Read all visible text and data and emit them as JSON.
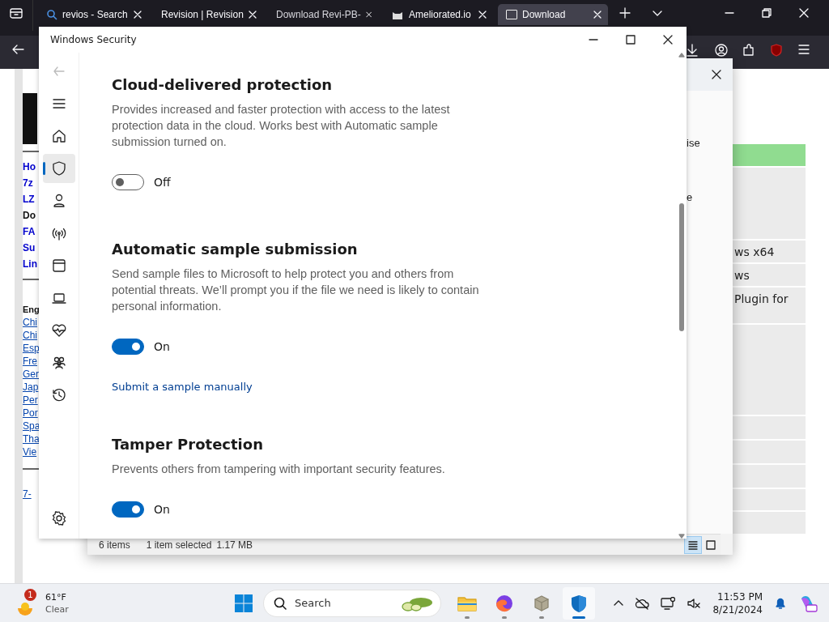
{
  "browser": {
    "tabs": [
      {
        "label": "revios - Search",
        "selected": false
      },
      {
        "label": "Revision | Revision",
        "selected": false
      },
      {
        "label": "Download Revi-PB-",
        "selected": false
      },
      {
        "label": "Ameliorated.io",
        "selected": false
      },
      {
        "label": "Download",
        "selected": true
      }
    ]
  },
  "web_page": {
    "nav_links": [
      {
        "text": "Ho",
        "kind": "link"
      },
      {
        "text": "7z",
        "kind": "link"
      },
      {
        "text": "LZ",
        "kind": "link"
      },
      {
        "text": "Do",
        "kind": "current"
      },
      {
        "text": "FA",
        "kind": "link"
      },
      {
        "text": "Su",
        "kind": "link"
      },
      {
        "text": "Lin",
        "kind": "link"
      }
    ],
    "languages_heading": "Eng",
    "languages": [
      "Chi",
      "Chi",
      "Esp",
      "Fre",
      "Ger",
      "Jap",
      "Per",
      "Por",
      "Spa",
      "Tha",
      "Vie"
    ],
    "footer_link": "7-",
    "table_rows": [
      {
        "text": "ws x64"
      },
      {
        "text": "ws"
      },
      {
        "text": "Plugin for"
      }
    ]
  },
  "file_explorer": {
    "pane_texts": [
      "ise",
      "e"
    ],
    "status_bar": {
      "item_count": "6 items",
      "selection": "1 item selected",
      "size": "1.17 MB"
    },
    "view_buttons": [
      {
        "selected": true
      },
      {
        "selected": false
      }
    ]
  },
  "security_window": {
    "title": "Windows Security",
    "nav": [
      {
        "selected": false
      },
      {
        "selected": true
      },
      {
        "selected": false
      },
      {
        "selected": false
      },
      {
        "selected": false
      },
      {
        "selected": false
      },
      {
        "selected": false
      },
      {
        "selected": false
      },
      {
        "selected": false
      },
      {
        "selected": false
      }
    ],
    "sections": [
      {
        "title": "Cloud-delivered protection",
        "description": "Provides increased and faster protection with access to the latest protection data in the cloud. Works best with Automatic sample submission turned on.",
        "toggle": {
          "on": false,
          "label": "Off"
        }
      },
      {
        "title": "Automatic sample submission",
        "description": "Send sample files to Microsoft to help protect you and others from potential threats. We’ll prompt you if the file we need is likely to contain personal information.",
        "toggle": {
          "on": true,
          "label": "On"
        },
        "link": "Submit a sample manually"
      },
      {
        "title": "Tamper Protection",
        "description": "Prevents others from tampering with important security features.",
        "toggle": {
          "on": true,
          "label": "On"
        }
      }
    ]
  },
  "taskbar": {
    "weather": {
      "badge": "1",
      "temperature": "61°F",
      "condition": "Clear"
    },
    "search": {
      "placeholder": "Search"
    },
    "apps": [
      {
        "selected": false
      },
      {
        "selected": false
      },
      {
        "selected": false
      },
      {
        "selected": true
      }
    ],
    "clock": {
      "time": "11:53 PM",
      "date": "8/21/2024"
    }
  }
}
